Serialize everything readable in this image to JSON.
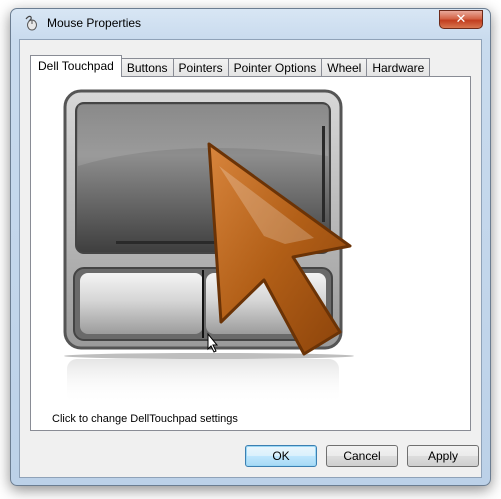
{
  "window": {
    "title": "Mouse Properties",
    "close_label": "✕"
  },
  "tabs": [
    {
      "label": "Dell Touchpad",
      "active": true
    },
    {
      "label": "Buttons",
      "active": false
    },
    {
      "label": "Pointers",
      "active": false
    },
    {
      "label": "Pointer Options",
      "active": false
    },
    {
      "label": "Wheel",
      "active": false
    },
    {
      "label": "Hardware",
      "active": false
    }
  ],
  "panel": {
    "hint": "Click to change DellTouchpad settings",
    "image_icon": "touchpad-with-orange-arrow"
  },
  "buttons": {
    "ok": "OK",
    "cancel": "Cancel",
    "apply": "Apply"
  },
  "colors": {
    "arrow": "#a9530f",
    "close_button": "#c9462a",
    "default_button_border": "#3c7fb1"
  }
}
